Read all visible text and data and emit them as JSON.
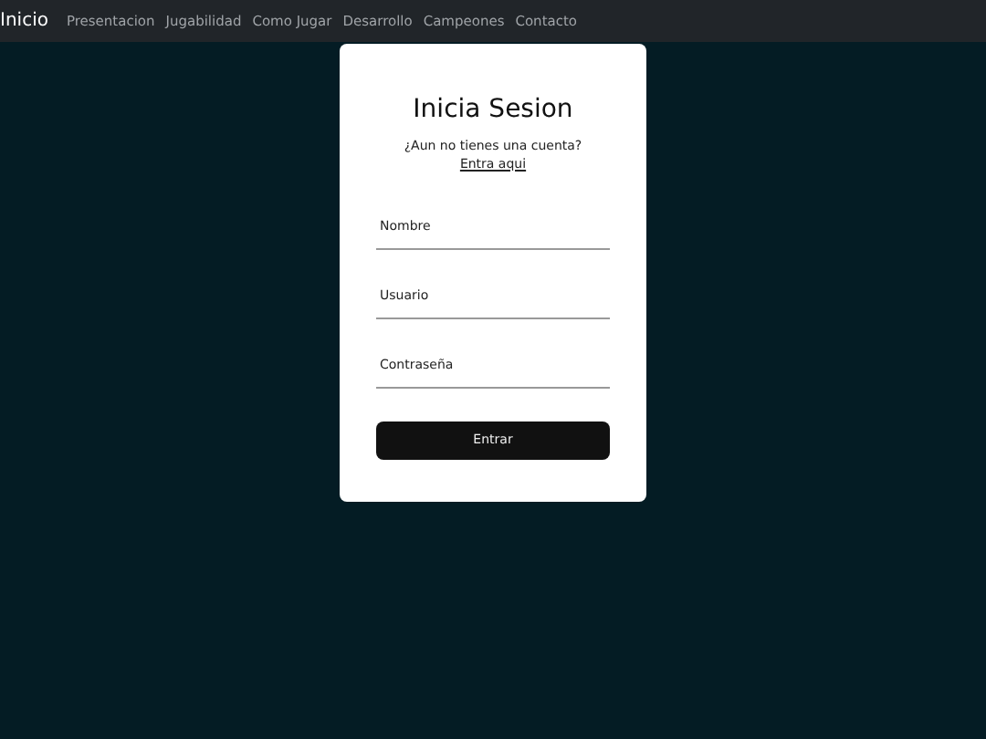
{
  "navbar": {
    "brand": "Inicio",
    "links": [
      "Presentacion",
      "Jugabilidad",
      "Como Jugar",
      "Desarrollo",
      "Campeones",
      "Contacto"
    ]
  },
  "login": {
    "title": "Inicia Sesion",
    "prompt": "¿Aun no tienes una cuenta?",
    "link": "Entra aqui",
    "fields": [
      {
        "placeholder": "Nombre"
      },
      {
        "placeholder": "Usuario"
      },
      {
        "placeholder": "Contraseña"
      }
    ],
    "button": "Entrar"
  }
}
